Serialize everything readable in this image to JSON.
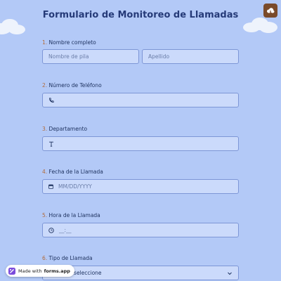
{
  "form": {
    "title": "Formulario de Monitoreo de Llamadas"
  },
  "questions": {
    "q1": {
      "number": "1.",
      "label": "Nombre completo",
      "first_placeholder": "Nombre de pila",
      "last_placeholder": "Apellido"
    },
    "q2": {
      "number": "2.",
      "label": "Número de Teléfono",
      "icon": "phone-icon",
      "value": ""
    },
    "q3": {
      "number": "3.",
      "label": "Departamento",
      "icon": "text-icon",
      "value": ""
    },
    "q4": {
      "number": "4.",
      "label": "Fecha de la Llamada",
      "icon": "calendar-icon",
      "placeholder": "MM/DD/YYYY"
    },
    "q5": {
      "number": "5.",
      "label": "Hora de la Llamada",
      "icon": "clock-icon",
      "placeholder": "__:__"
    },
    "q6": {
      "number": "6.",
      "label": "Tipo de Llamada",
      "selected": "Por favor seleccione"
    }
  },
  "badge": {
    "prefix": "Made with",
    "brand": "forms.app"
  },
  "colors": {
    "background": "#b3c9f7",
    "field_background": "#cbdafb",
    "field_border": "#7d96d6",
    "title": "#253a78",
    "question_number": "#b26b3a",
    "theme_button": "#7a4a2a"
  }
}
